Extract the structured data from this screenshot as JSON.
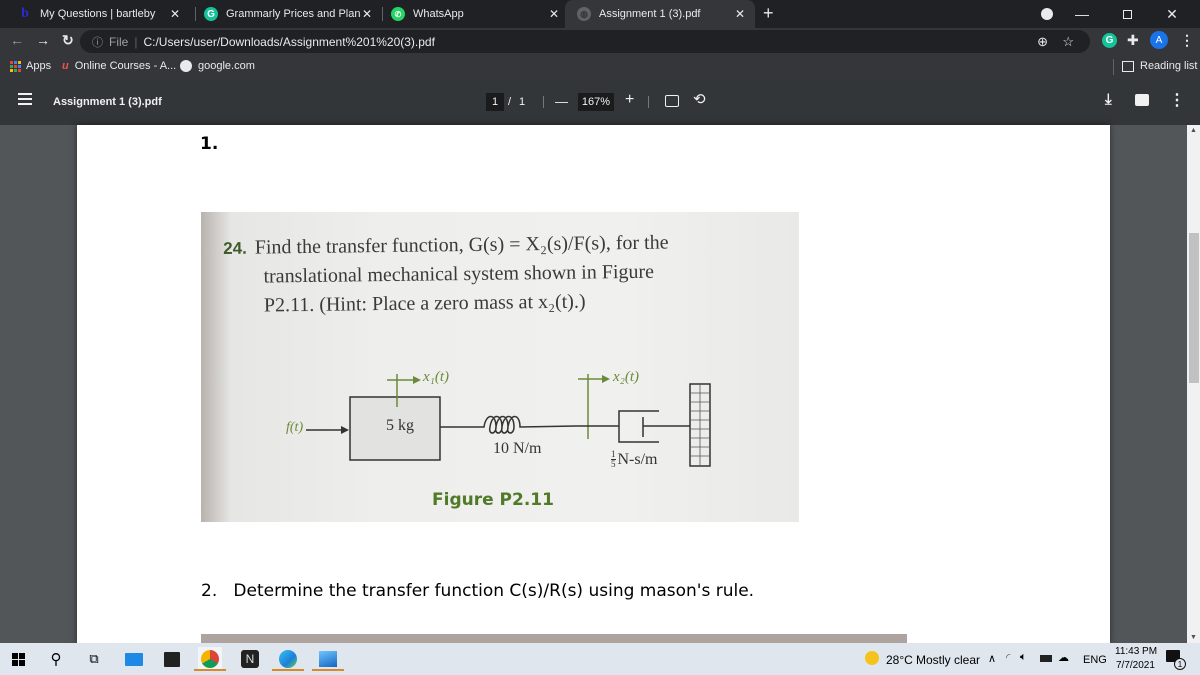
{
  "browser": {
    "tabs": [
      {
        "title": "My Questions | bartleby",
        "favicon": "bartleby-icon",
        "active": false
      },
      {
        "title": "Grammarly Prices and Plans | Gra",
        "favicon": "grammarly-icon",
        "active": false
      },
      {
        "title": "WhatsApp",
        "favicon": "whatsapp-icon",
        "active": false
      },
      {
        "title": "Assignment 1 (3).pdf",
        "favicon": "globe-icon",
        "active": true
      }
    ],
    "new_tab": "+",
    "address": {
      "scheme_label": "File",
      "url": "C:/Users/user/Downloads/Assignment%201%20(3).pdf"
    },
    "profile_initial": "A",
    "bookmarks": [
      {
        "label": "Apps",
        "icon": "apps-grid-icon"
      },
      {
        "label": "Online Courses - A...",
        "icon": "udemy-icon"
      },
      {
        "label": "google.com",
        "icon": "globe-icon"
      }
    ],
    "reading_list": "Reading list"
  },
  "pdf_viewer": {
    "title": "Assignment 1 (3).pdf",
    "current_page": "1",
    "page_separator": "/",
    "total_pages": "1",
    "zoom": "167%",
    "zoom_out": "—",
    "zoom_in": "+"
  },
  "document": {
    "q1_number": "1.",
    "problem": {
      "number": "24.",
      "line1": "Find the transfer function, G(s) = X₂(s)/F(s), for the",
      "line2": "translational mechanical system shown in Figure",
      "line3": "P2.11. (Hint: Place a zero mass at x₂(t).)"
    },
    "figure": {
      "x1_label": "x₁(t)",
      "x2_label": "x₂(t)",
      "force_label": "f(t)",
      "mass_label": "5 kg",
      "spring_label": "10 N/m",
      "damper_label_num": "1",
      "damper_label_den": "5",
      "damper_label_unit": "N-s/m",
      "caption": "Figure P2.11"
    },
    "q2": "2.   Determine the transfer function C(s)/R(s) using mason's rule."
  },
  "taskbar": {
    "weather_temp": "28°C",
    "weather_text": "Mostly clear",
    "language": "ENG",
    "time": "11:43 PM",
    "date": "7/7/2021",
    "notification_count": "1"
  }
}
